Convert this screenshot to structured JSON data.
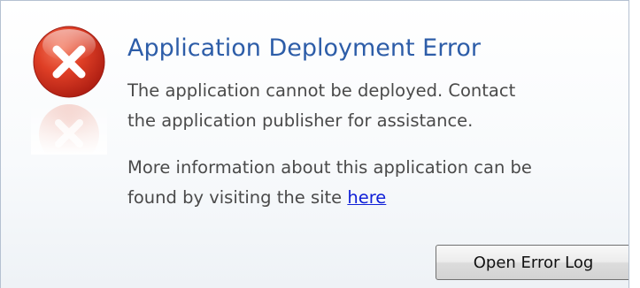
{
  "dialog": {
    "title": "Application Deployment Error",
    "message_lines": [
      "The application cannot be deployed. Contact",
      "the application publisher for assistance."
    ],
    "info_line_1": "More information about this application can be",
    "info_line_2_prefix": "found by visiting the site ",
    "info_link_label": "here",
    "open_error_log_label": "Open Error Log",
    "icon": "error-x-icon",
    "colors": {
      "title": "#2d5da8",
      "link": "#1020d8",
      "icon_red": "#d63a26"
    }
  }
}
